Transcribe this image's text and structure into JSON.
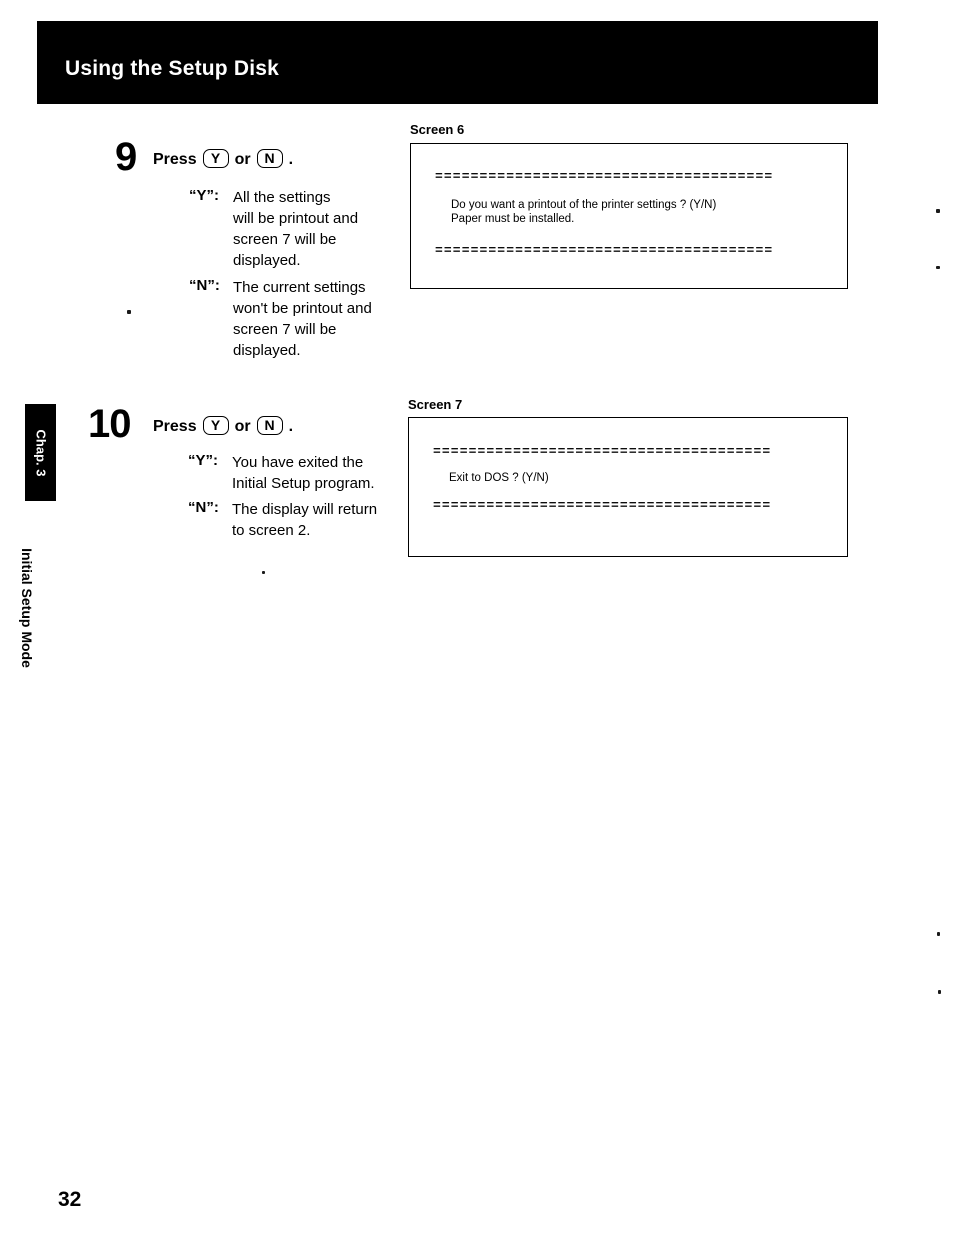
{
  "page": {
    "header_title": "Using the Setup Disk",
    "page_number": "32",
    "side_chapter_tab": "Chap. 3",
    "side_mode_label": "Initial Setup Mode"
  },
  "steps": [
    {
      "number": "9",
      "press_label": "Press",
      "key_y": "Y",
      "or_label": "or",
      "key_n": "N",
      "period": ".",
      "options": [
        {
          "key": "“Y”:",
          "text": "All the settings\nwill be printout and\nscreen 7 will be\ndisplayed."
        },
        {
          "key": "“N”:",
          "text": "The current settings\nwon't be printout and\nscreen 7 will be\ndisplayed."
        }
      ]
    },
    {
      "number": "10",
      "press_label": "Press",
      "key_y": "Y",
      "or_label": "or",
      "key_n": "N",
      "period": ".",
      "options": [
        {
          "key": "“Y”:",
          "text": "You have exited the\nInitial Setup program."
        },
        {
          "key": "“N”:",
          "text": "The display will return\nto screen 2."
        }
      ]
    }
  ],
  "screens": [
    {
      "caption": "Screen 6",
      "rule_top": "======================================",
      "rule_bottom": "======================================",
      "body": "Do you want a printout of the printer settings  ?  (Y/N)\nPaper must be installed."
    },
    {
      "caption": "Screen 7",
      "rule_top": "======================================",
      "rule_bottom": "======================================",
      "body": "Exit to DOS  ?  (Y/N)"
    }
  ]
}
